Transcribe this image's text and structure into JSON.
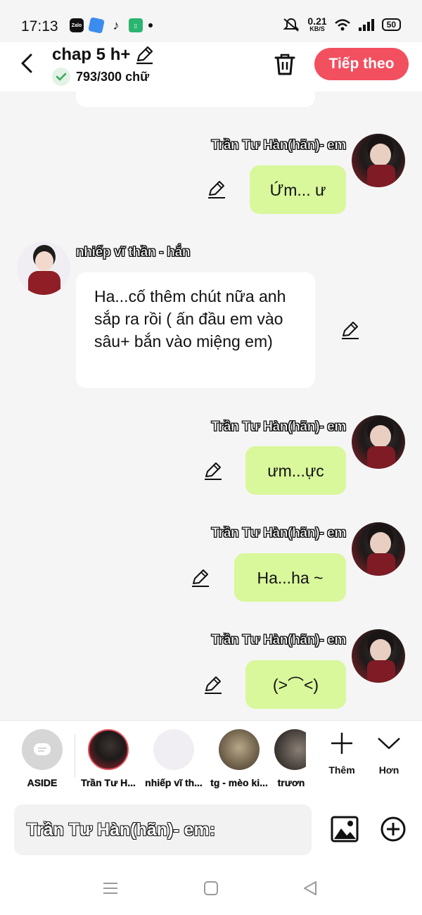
{
  "status_bar": {
    "time": "17:13",
    "apps": [
      "Zalo",
      "blue-app",
      "tiktok",
      "green-app"
    ],
    "net_speed_value": "0.21",
    "net_speed_unit": "KB/S",
    "battery": "50"
  },
  "header": {
    "title": "chap 5 h+",
    "word_count": "793/300 chữ",
    "next_label": "Tiếp theo"
  },
  "messages": [
    {
      "sender": "Trần Tư Hàn(hãn)- em",
      "side": "right",
      "text": "Ứm... ư"
    },
    {
      "sender": "nhiếp vĩ thần - hắn",
      "side": "left",
      "text": "Ha...cố thêm chút nữa anh sắp ra rồi ( ấn đầu em vào sâu+ bắn vào miệng em)"
    },
    {
      "sender": "Trần Tư Hàn(hãn)- em",
      "side": "right",
      "text": "ưm...ực"
    },
    {
      "sender": "Trần Tư Hàn(hãn)- em",
      "side": "right",
      "text": "Ha...ha ~"
    },
    {
      "sender": "Trần Tư Hàn(hãn)- em",
      "side": "right",
      "text": "(˃⌒˂)"
    }
  ],
  "characters": [
    {
      "label": "ASIDE"
    },
    {
      "label": "Trần Tư H..."
    },
    {
      "label": "nhiếp vĩ th..."
    },
    {
      "label": "tg - mèo ki..."
    },
    {
      "label": "trươn"
    }
  ],
  "tools": {
    "add_label": "Thêm",
    "more_label": "Hơn"
  },
  "input": {
    "value": "Trần Tư Hàn(hãn)- em:"
  },
  "colors": {
    "accent": "#f24f5f",
    "bubble_green": "#d9f79b",
    "bubble_white": "#ffffff",
    "background": "#f5f5f5"
  }
}
